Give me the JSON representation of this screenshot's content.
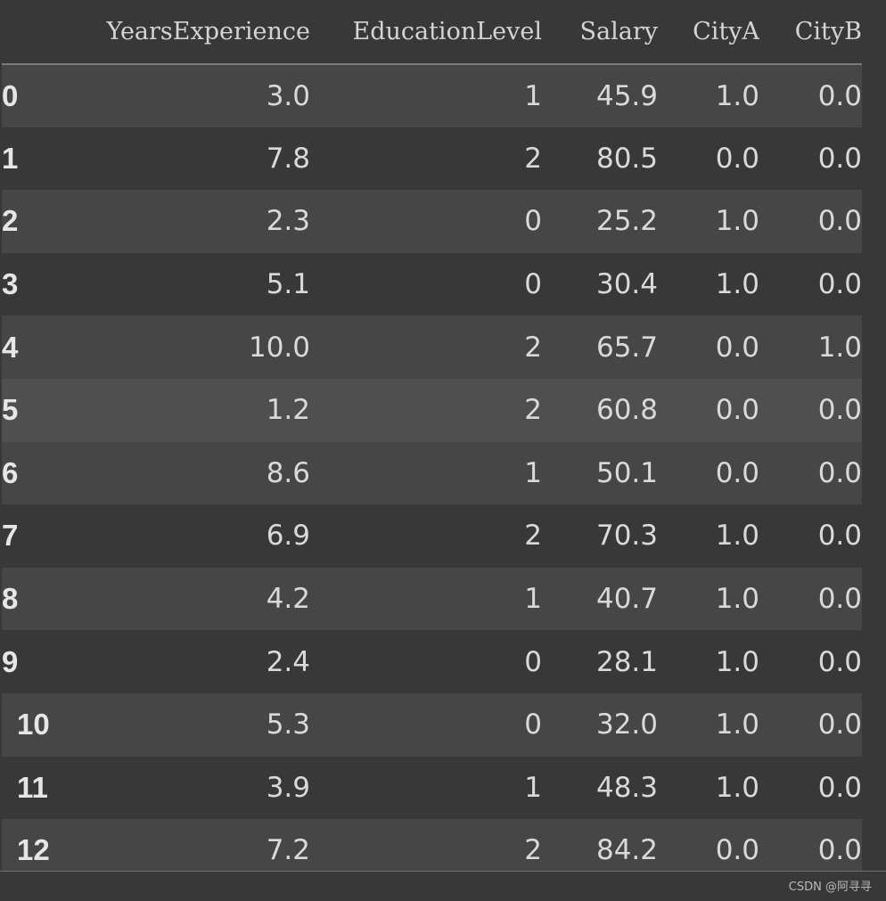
{
  "table": {
    "index_header": "",
    "columns": [
      "YearsExperience",
      "EducationLevel",
      "Salary",
      "CityA",
      "CityB"
    ],
    "rows": [
      {
        "index": "0",
        "cells": [
          "3.0",
          "1",
          "45.9",
          "1.0",
          "0.0"
        ]
      },
      {
        "index": "1",
        "cells": [
          "7.8",
          "2",
          "80.5",
          "0.0",
          "0.0"
        ]
      },
      {
        "index": "2",
        "cells": [
          "2.3",
          "0",
          "25.2",
          "1.0",
          "0.0"
        ]
      },
      {
        "index": "3",
        "cells": [
          "5.1",
          "0",
          "30.4",
          "1.0",
          "0.0"
        ]
      },
      {
        "index": "4",
        "cells": [
          "10.0",
          "2",
          "65.7",
          "0.0",
          "1.0"
        ]
      },
      {
        "index": "5",
        "cells": [
          "1.2",
          "2",
          "60.8",
          "0.0",
          "0.0"
        ]
      },
      {
        "index": "6",
        "cells": [
          "8.6",
          "1",
          "50.1",
          "0.0",
          "0.0"
        ]
      },
      {
        "index": "7",
        "cells": [
          "6.9",
          "2",
          "70.3",
          "1.0",
          "0.0"
        ]
      },
      {
        "index": "8",
        "cells": [
          "4.2",
          "1",
          "40.7",
          "1.0",
          "0.0"
        ]
      },
      {
        "index": "9",
        "cells": [
          "2.4",
          "0",
          "28.1",
          "1.0",
          "0.0"
        ]
      },
      {
        "index": "10",
        "cells": [
          "5.3",
          "0",
          "32.0",
          "1.0",
          "0.0"
        ]
      },
      {
        "index": "11",
        "cells": [
          "3.9",
          "1",
          "48.3",
          "1.0",
          "0.0"
        ]
      },
      {
        "index": "12",
        "cells": [
          "7.2",
          "2",
          "84.2",
          "0.0",
          "0.0"
        ]
      }
    ],
    "hovered_row": 5
  },
  "watermark": "CSDN @阿寻寻",
  "colors": {
    "background": "#383838",
    "row_striped": "#464646",
    "row_hover": "#4f4f4f",
    "text": "#d9d9d9"
  }
}
